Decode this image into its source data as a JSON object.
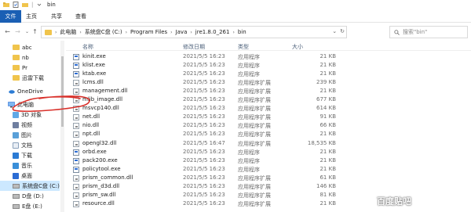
{
  "window": {
    "title": "bin",
    "colors": {
      "accent": "#1a5fb4",
      "selected": "#cce8ff",
      "folder": "#f0c44c",
      "annotation": "#d9302a"
    }
  },
  "ribbon": {
    "tabs": [
      "文件",
      "主页",
      "共享",
      "查看"
    ]
  },
  "address": {
    "crumbs": [
      "此电脑",
      "系统盘C盘 (C:)",
      "Program Files",
      "Java",
      "jre1.8.0_261",
      "bin"
    ]
  },
  "search": {
    "placeholder": "搜索\"bin\""
  },
  "sidebar": {
    "items": [
      {
        "label": "abc",
        "icon": "folder-icon"
      },
      {
        "label": "nb",
        "icon": "folder-icon"
      },
      {
        "label": "Pr",
        "icon": "folder-icon"
      },
      {
        "label": "迅雷下载",
        "icon": "folder-icon"
      },
      {
        "label": "OneDrive",
        "icon": "cloud-icon"
      },
      {
        "label": "此电脑",
        "icon": "computer-icon"
      },
      {
        "label": "3D 对象",
        "icon": "cube-icon"
      },
      {
        "label": "视频",
        "icon": "video-icon"
      },
      {
        "label": "图片",
        "icon": "picture-icon"
      },
      {
        "label": "文档",
        "icon": "document-icon"
      },
      {
        "label": "下载",
        "icon": "download-icon"
      },
      {
        "label": "音乐",
        "icon": "music-icon"
      },
      {
        "label": "桌面",
        "icon": "desktop-icon"
      },
      {
        "label": "系统盘C盘 (C:)",
        "icon": "drive-icon"
      },
      {
        "label": "D盘 (D:)",
        "icon": "drive-icon"
      },
      {
        "label": "E盘 (E:)",
        "icon": "drive-icon"
      }
    ]
  },
  "columns": {
    "name": "名称",
    "date": "修改日期",
    "type": "类型",
    "size": "大小"
  },
  "files": [
    {
      "name": "kinit.exe",
      "date": "2021/5/5 16:23",
      "type": "应用程序",
      "size": "21 KB",
      "kind": "exe"
    },
    {
      "name": "klist.exe",
      "date": "2021/5/5 16:23",
      "type": "应用程序",
      "size": "21 KB",
      "kind": "exe"
    },
    {
      "name": "ktab.exe",
      "date": "2021/5/5 16:23",
      "type": "应用程序",
      "size": "21 KB",
      "kind": "exe"
    },
    {
      "name": "lcms.dll",
      "date": "2021/5/5 16:23",
      "type": "应用程序扩展",
      "size": "239 KB",
      "kind": "dll"
    },
    {
      "name": "management.dll",
      "date": "2021/5/5 16:23",
      "type": "应用程序扩展",
      "size": "21 KB",
      "kind": "dll"
    },
    {
      "name": "mlib_image.dll",
      "date": "2021/5/5 16:23",
      "type": "应用程序扩展",
      "size": "677 KB",
      "kind": "dll"
    },
    {
      "name": "msvcp140.dll",
      "date": "2021/5/5 16:23",
      "type": "应用程序扩展",
      "size": "614 KB",
      "kind": "dll"
    },
    {
      "name": "net.dll",
      "date": "2021/5/5 16:23",
      "type": "应用程序扩展",
      "size": "91 KB",
      "kind": "dll"
    },
    {
      "name": "nio.dll",
      "date": "2021/5/5 16:23",
      "type": "应用程序扩展",
      "size": "66 KB",
      "kind": "dll"
    },
    {
      "name": "npt.dll",
      "date": "2021/5/5 16:23",
      "type": "应用程序扩展",
      "size": "21 KB",
      "kind": "dll"
    },
    {
      "name": "opengl32.dll",
      "date": "2021/5/5 16:47",
      "type": "应用程序扩展",
      "size": "18,535 KB",
      "kind": "dll"
    },
    {
      "name": "orbd.exe",
      "date": "2021/5/5 16:23",
      "type": "应用程序",
      "size": "21 KB",
      "kind": "exe"
    },
    {
      "name": "pack200.exe",
      "date": "2021/5/5 16:23",
      "type": "应用程序",
      "size": "21 KB",
      "kind": "exe"
    },
    {
      "name": "policytool.exe",
      "date": "2021/5/5 16:23",
      "type": "应用程序",
      "size": "21 KB",
      "kind": "exe"
    },
    {
      "name": "prism_common.dll",
      "date": "2021/5/5 16:23",
      "type": "应用程序扩展",
      "size": "61 KB",
      "kind": "dll"
    },
    {
      "name": "prism_d3d.dll",
      "date": "2021/5/5 16:23",
      "type": "应用程序扩展",
      "size": "146 KB",
      "kind": "dll"
    },
    {
      "name": "prism_sw.dll",
      "date": "2021/5/5 16:23",
      "type": "应用程序扩展",
      "size": "81 KB",
      "kind": "dll"
    },
    {
      "name": "resource.dll",
      "date": "2021/5/5 16:23",
      "type": "应用程序扩展",
      "size": "21 KB",
      "kind": "dll"
    }
  ],
  "watermark": "百度贴吧"
}
